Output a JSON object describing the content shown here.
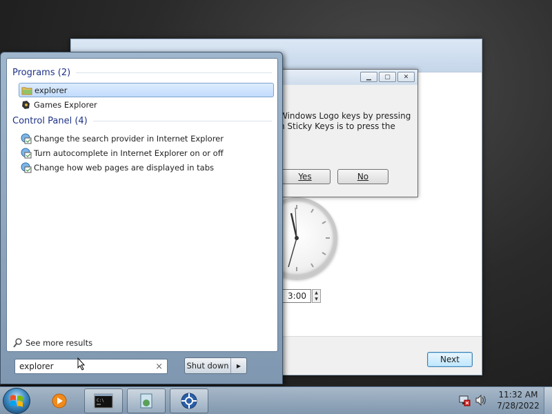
{
  "setup": {
    "next_label": "Next",
    "time_value": "3:00"
  },
  "dialog": {
    "text": "Windows Logo keys by pressing\nn Sticky Keys is to press the",
    "yes_label": "Yes",
    "no_label": "No",
    "minimize_glyph": "▁",
    "maximize_glyph": "▢",
    "close_glyph": "✕"
  },
  "start_menu": {
    "programs_header": "Programs (2)",
    "programs": [
      {
        "label": "explorer",
        "icon": "folder-icon",
        "selected": true
      },
      {
        "label": "Games Explorer",
        "icon": "games-icon",
        "selected": false
      }
    ],
    "control_panel_header": "Control Panel (4)",
    "control_panel": [
      {
        "label": "Change the search provider in Internet Explorer",
        "icon": "internet-options-icon"
      },
      {
        "label": "Turn autocomplete in Internet Explorer on or off",
        "icon": "internet-options-icon"
      },
      {
        "label": "Change how web pages are displayed in tabs",
        "icon": "internet-options-icon"
      }
    ],
    "see_more": "See more results",
    "search_value": "explorer",
    "clear_glyph": "×",
    "shutdown_label": "Shut down",
    "shutdown_arrow": "▶"
  },
  "taskbar": {
    "time": "11:32 AM",
    "date": "7/28/2022",
    "pinned": [
      "media-player-icon",
      "command-prompt-icon",
      "setup-icon",
      "network-icon"
    ],
    "tray": [
      "network-warning-icon",
      "volume-icon"
    ]
  }
}
